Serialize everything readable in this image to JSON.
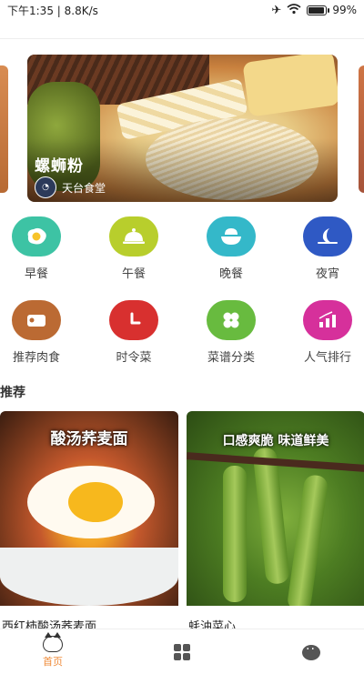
{
  "status_bar": {
    "time": "下午1:35",
    "network_speed": "8.8K/s",
    "battery": "99",
    "battery_suffix": "%",
    "battery_level": 0.99,
    "icons": [
      "airplane-icon",
      "wifi-icon",
      "battery-icon"
    ]
  },
  "banner": {
    "title": "螺蛳粉",
    "author": "天台食堂"
  },
  "categories": {
    "row1": [
      {
        "label": "早餐",
        "icon": "fried-egg-icon",
        "color": "#3dc3a4"
      },
      {
        "label": "午餐",
        "icon": "cloche-icon",
        "color": "#b8ce2c"
      },
      {
        "label": "晚餐",
        "icon": "bowl-icon",
        "color": "#34b8c9"
      },
      {
        "label": "夜宵",
        "icon": "moon-icon",
        "color": "#2f59c4"
      }
    ],
    "row2": [
      {
        "label": "推荐肉食",
        "icon": "meat-icon",
        "color": "#bb6a33"
      },
      {
        "label": "时令菜",
        "icon": "clock-icon",
        "color": "#d8302f"
      },
      {
        "label": "菜谱分类",
        "icon": "clover-icon",
        "color": "#68bb3f"
      },
      {
        "label": "人气排行",
        "icon": "bar-chart-icon",
        "color": "#d6309b"
      }
    ]
  },
  "recommend": {
    "title": "推荐",
    "cards": [
      {
        "overlay": "酸汤荞麦面",
        "name": "西红柿酸汤荞麦面"
      },
      {
        "overlay": "口感爽脆 味道鲜美",
        "name": "蚝油菜心"
      }
    ]
  },
  "tab_bar": {
    "home_label": "首页",
    "accent": "#ef8b3a"
  }
}
